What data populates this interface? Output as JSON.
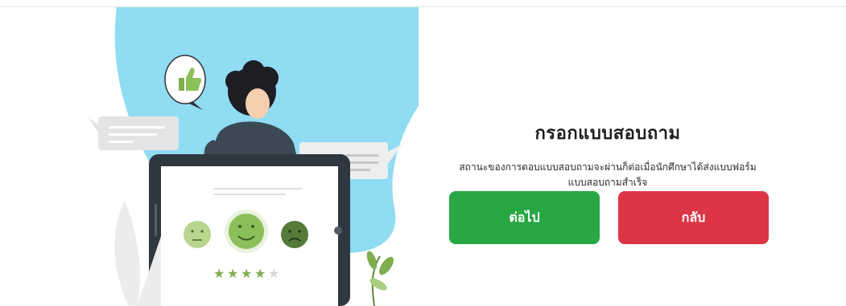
{
  "survey": {
    "title": "กรอกแบบสอบถาม",
    "description_line1": "สถานะของการตอบแบบสอบถามจะผ่านก็ต่อเมื่อนักศึกษาได้ส่งแบบฟอร์ม",
    "description_line2": "แบบสอบถามสำเร็จ",
    "next_label": "ต่อไป",
    "back_label": "กลับ"
  },
  "illustration": {
    "name": "survey-feedback-illustration",
    "rating_stars_filled": 4,
    "rating_stars_total": 5
  },
  "colors": {
    "next": "#28a745",
    "back": "#dc3545",
    "blob": "#8fdcf3",
    "tablet": "#2f3740",
    "face": "#8cbf5a"
  }
}
